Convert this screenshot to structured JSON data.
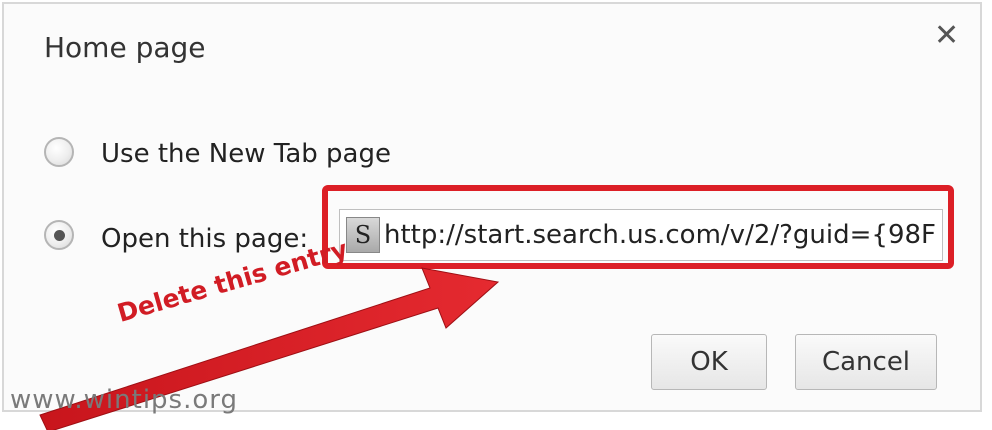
{
  "dialog": {
    "title": "Home page",
    "close_icon": "close-icon"
  },
  "options": [
    {
      "label": "Use the New Tab page",
      "checked": false
    },
    {
      "label": "Open this page:",
      "checked": true
    }
  ],
  "url_field": {
    "favicon_letter": "S",
    "value": "http://start.search.us.com/v/2/?guid={98F"
  },
  "buttons": {
    "ok_label": "OK",
    "cancel_label": "Cancel"
  },
  "annotation": {
    "text": "Delete this entry",
    "color": "#d11c24"
  },
  "watermark": "www.wintips.org"
}
